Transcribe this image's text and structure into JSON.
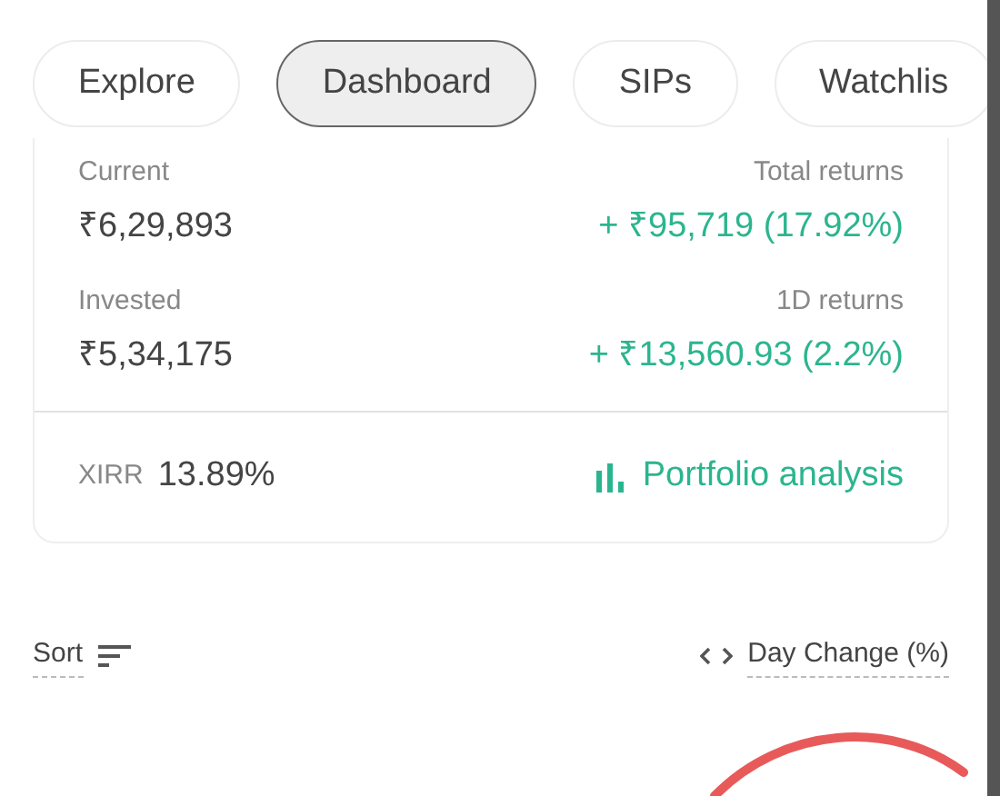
{
  "tabs": [
    {
      "label": "Explore",
      "selected": false
    },
    {
      "label": "Dashboard",
      "selected": true
    },
    {
      "label": "SIPs",
      "selected": false
    },
    {
      "label": "Watchlis",
      "selected": false
    }
  ],
  "summary": {
    "stats": [
      {
        "label": "Current",
        "value": "₹6,29,893",
        "returns_label": "Total returns",
        "returns": "+ ₹95,719 (17.92%)"
      },
      {
        "label": "Invested",
        "value": "₹5,34,175",
        "returns_label": "1D returns",
        "returns": "+ ₹13,560.93 (2.2%)"
      }
    ],
    "xirr_label": "XIRR",
    "xirr_value": "13.89%",
    "analysis_link": "Portfolio analysis"
  },
  "sort_label": "Sort",
  "column_toggle": "Day Change (%)"
}
